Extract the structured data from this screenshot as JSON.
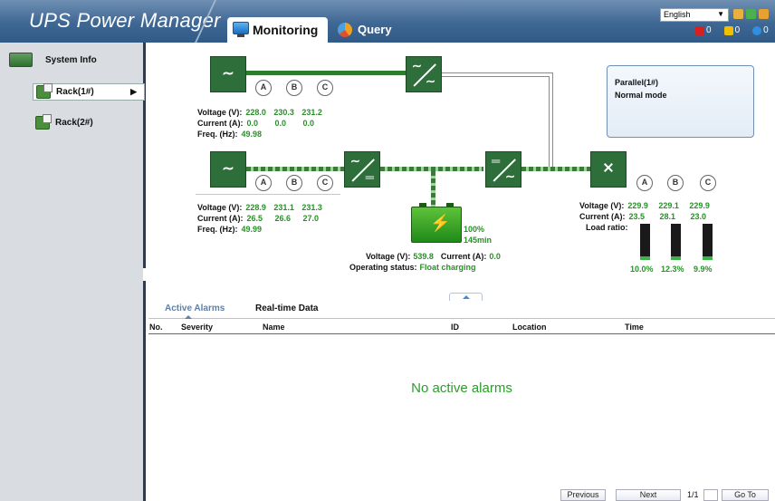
{
  "header": {
    "app_title": "UPS Power Manager",
    "tabs": {
      "monitoring": "Monitoring",
      "query": "Query"
    },
    "language": "English",
    "counters": {
      "critical": "0",
      "major": "0",
      "minor": "0"
    },
    "colors": {
      "critical": "#d82020",
      "major": "#f0c000",
      "minor": "#2f8fe0"
    }
  },
  "sidebar": {
    "system_info": "System Info",
    "racks": [
      "Rack(1#)",
      "Rack(2#)"
    ]
  },
  "diagram": {
    "mains": {
      "phases": [
        "A",
        "B",
        "C"
      ],
      "voltage_label": "Voltage (V):",
      "voltage": [
        "228.0",
        "230.3",
        "231.2"
      ],
      "current_label": "Current (A):",
      "current": [
        "0.0",
        "0.0",
        "0.0"
      ],
      "freq_label": "Freq. (Hz):",
      "freq": "49.98"
    },
    "bypass": {
      "phases": [
        "A",
        "B",
        "C"
      ],
      "voltage_label": "Voltage (V):",
      "voltage": [
        "228.9",
        "231.1",
        "231.3"
      ],
      "current_label": "Current (A):",
      "current": [
        "26.5",
        "26.6",
        "27.0"
      ],
      "freq_label": "Freq. (Hz):",
      "freq": "49.99"
    },
    "battery": {
      "capacity": "100%",
      "backup_time": "145min",
      "voltage_label": "Voltage (V):",
      "voltage": "539.8",
      "current_label": "Current (A):",
      "current": "0.0",
      "status_label": "Operating status:",
      "status": "Float charging"
    },
    "output": {
      "phases": [
        "A",
        "B",
        "C"
      ],
      "voltage_label": "Voltage (V):",
      "voltage": [
        "229.9",
        "229.1",
        "229.9"
      ],
      "current_label": "Current (A):",
      "current": [
        "23.5",
        "28.1",
        "23.0"
      ],
      "load_label": "Load ratio:",
      "load_ratio": [
        "10.0%",
        "12.3%",
        "9.9%"
      ],
      "load_values": [
        10.0,
        12.3,
        9.9
      ]
    },
    "status_panel": {
      "line1": "Parallel(1#)",
      "line2": "Normal mode"
    }
  },
  "alarms": {
    "tabs": [
      "Active Alarms",
      "Real-time Data"
    ],
    "columns": [
      "No.",
      "Severity",
      "Name",
      "ID",
      "Location",
      "Time"
    ],
    "empty_message": "No active alarms",
    "pager": {
      "previous": "Previous",
      "next": "Next",
      "page": "1/1",
      "goto": "Go To"
    }
  }
}
